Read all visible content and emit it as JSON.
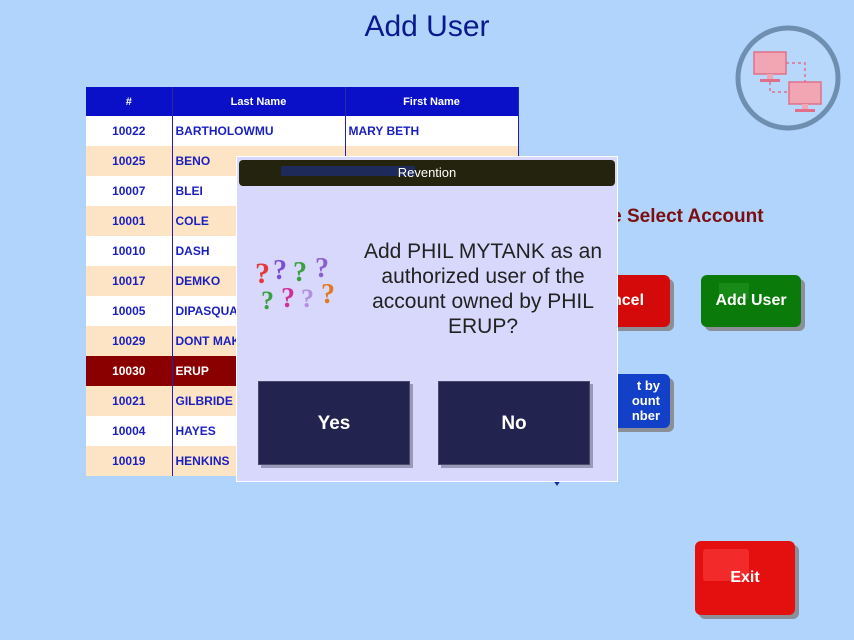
{
  "page": {
    "title": "Add User"
  },
  "table": {
    "headers": [
      "#",
      "Last Name",
      "First Name"
    ],
    "rows": [
      {
        "num": "10022",
        "last": "BARTHOLOWMU",
        "first": "MARY BETH"
      },
      {
        "num": "10025",
        "last": "BENO",
        "first": ""
      },
      {
        "num": "10007",
        "last": "BLEI",
        "first": ""
      },
      {
        "num": "10001",
        "last": "COLE",
        "first": ""
      },
      {
        "num": "10010",
        "last": "DASH",
        "first": ""
      },
      {
        "num": "10017",
        "last": "DEMKO",
        "first": ""
      },
      {
        "num": "10005",
        "last": "DIPASQUAI",
        "first": ""
      },
      {
        "num": "10029",
        "last": "DONT MAK",
        "first": ""
      },
      {
        "num": "10030",
        "last": "ERUP",
        "first": ""
      },
      {
        "num": "10021",
        "last": "GILBRIDE",
        "first": ""
      },
      {
        "num": "10004",
        "last": "HAYES",
        "first": ""
      },
      {
        "num": "10019",
        "last": "HENKINS",
        "first": ""
      }
    ],
    "selected_index": 8
  },
  "prompt": "ase Select Account",
  "buttons": {
    "cancel": "ncel",
    "add_user": "Add User",
    "sort_lines": [
      "t by",
      "ount",
      "nber"
    ],
    "exit": "Exit"
  },
  "dialog": {
    "title": "Revention",
    "message": "Add PHIL MYTANK as an authorized user of the account owned by PHIL ERUP?",
    "yes": "Yes",
    "no": "No"
  },
  "icons": {
    "logo": "network-computers-icon",
    "question": "question-marks-icon"
  },
  "colors": {
    "background": "#b0d4fb",
    "title": "#0a1a8c",
    "header": "#0a10c8",
    "selected_row": "#8a0000",
    "cancel": "#d40a0a",
    "add_user": "#0a7a0a",
    "sort": "#1240c8",
    "exit": "#e41010",
    "dialog_bg": "#d8d8fc",
    "dialog_button": "#22234e"
  }
}
